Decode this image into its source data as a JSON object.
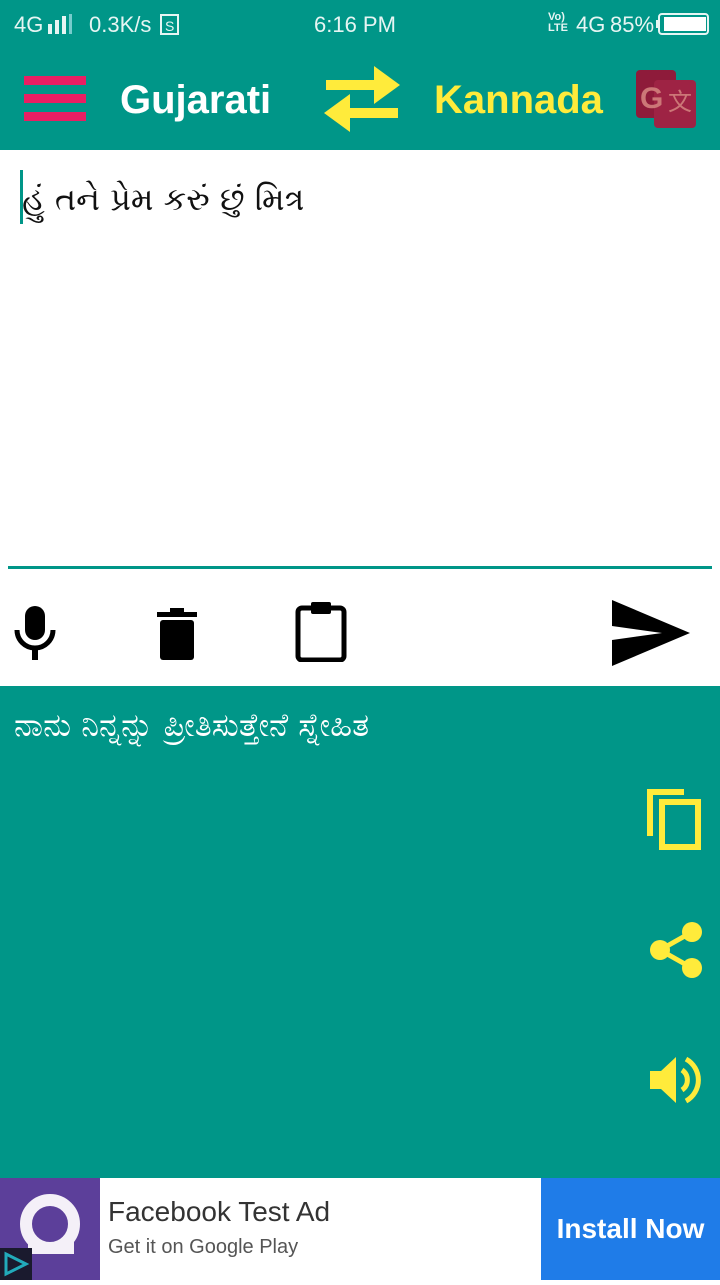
{
  "status_bar": {
    "network": "4G",
    "speed": "0.3K/s",
    "time": "6:16 PM",
    "volte": "Vo) LTE",
    "network2": "4G",
    "battery": "85%"
  },
  "toolbar": {
    "source_language": "Gujarati",
    "target_language": "Kannada",
    "colors": {
      "bar": "#009688",
      "menu": "#e91e63",
      "accent": "#ffeb3b"
    }
  },
  "input": {
    "text": "હું તને પ્રેમ કરું છું મિત્ર"
  },
  "output": {
    "text": "ನಾನು ನಿನ್ನನ್ನು ಪ್ರೀತಿಸುತ್ತೇನೆ ಸ್ನೇಹಿತ"
  },
  "ad": {
    "title": "Facebook Test Ad",
    "subtitle": "Get it on Google Play",
    "cta": "Install Now"
  }
}
